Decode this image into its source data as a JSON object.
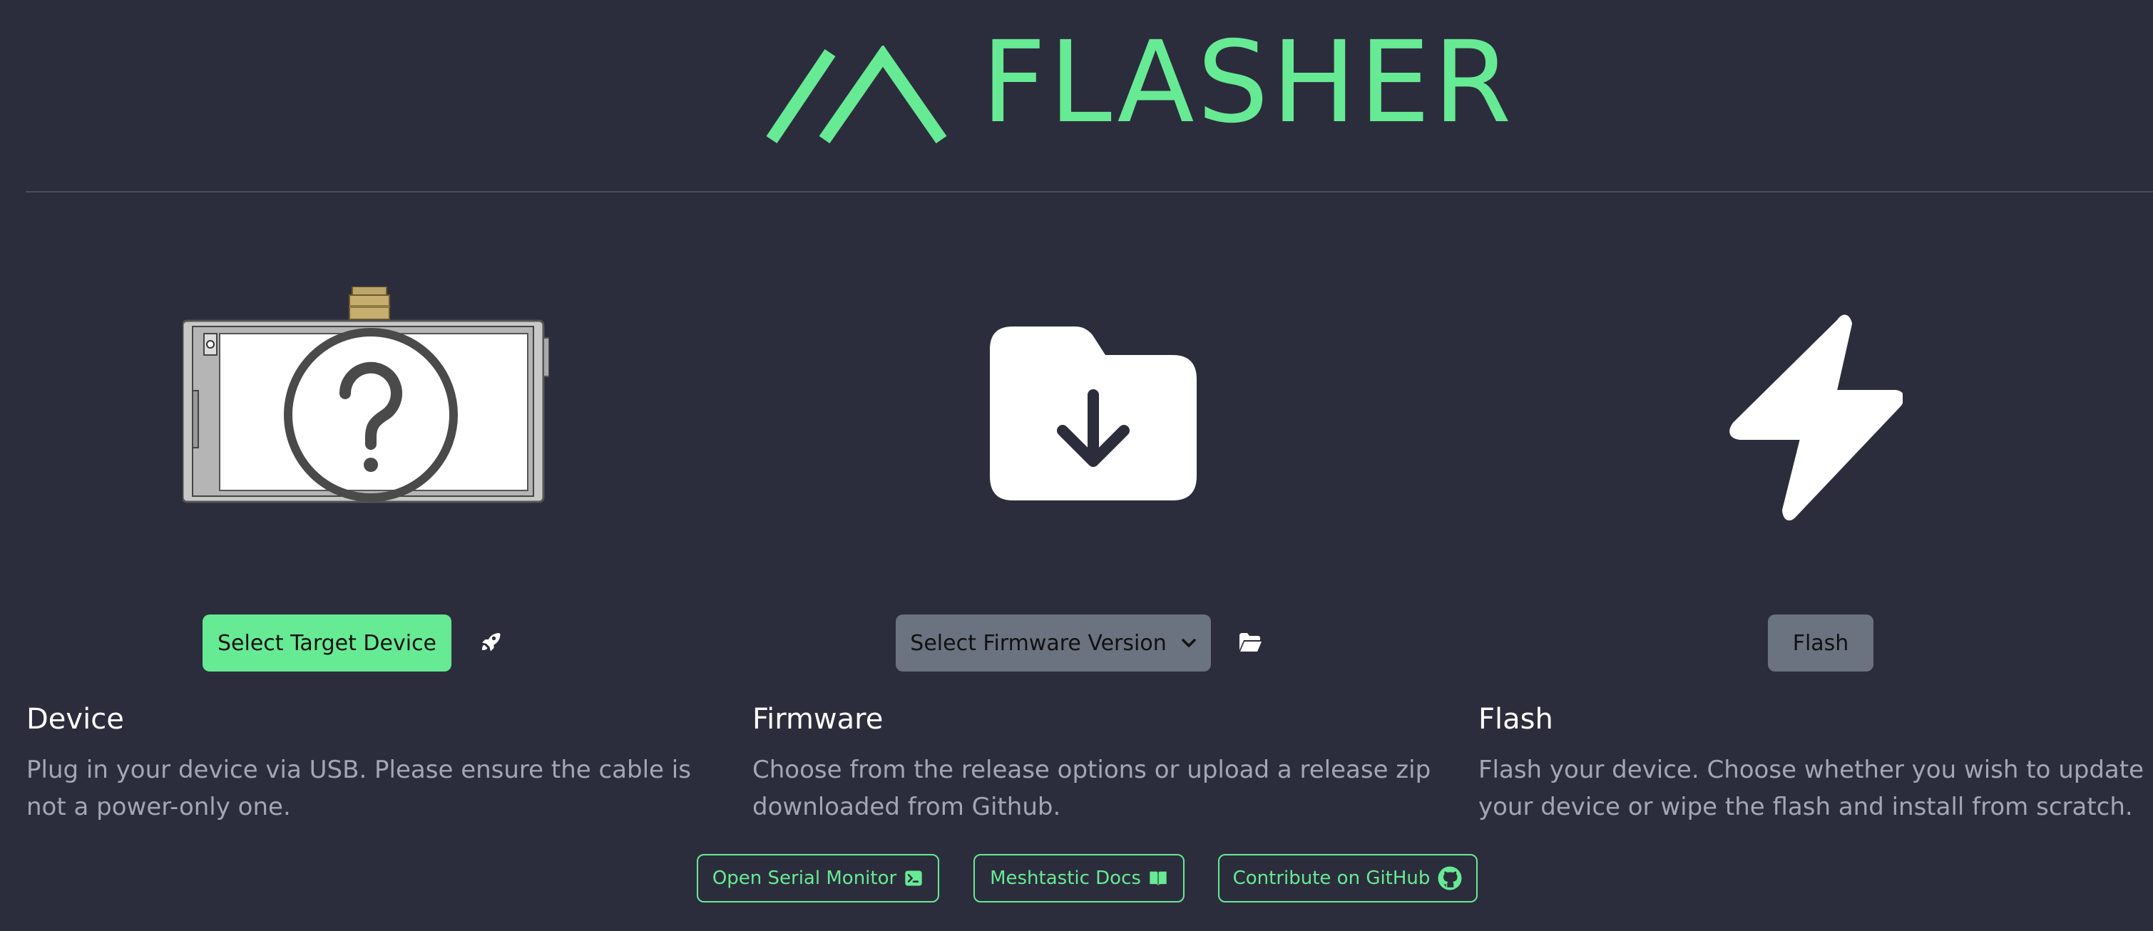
{
  "header": {
    "title": "FLASHER",
    "logo_icon": "meshtastic-logo-icon",
    "accent_color": "#67ea94"
  },
  "columns": {
    "device": {
      "button_label": "Select Target Device",
      "title": "Device",
      "description": "Plug in your device via USB. Please ensure the cable is not a power-only one.",
      "illustration": "unknown-device-icon",
      "extra_icon": "rocket-icon"
    },
    "firmware": {
      "button_label": "Select Firmware Version",
      "title": "Firmware",
      "description": "Choose from the release options or upload a release zip downloaded from Github.",
      "illustration": "folder-download-icon",
      "extra_icon": "folder-open-icon"
    },
    "flash": {
      "button_label": "Flash",
      "title": "Flash",
      "description": "Flash your device. Choose whether you wish to update your device or wipe the flash and install from scratch.",
      "illustration": "lightning-bolt-icon"
    }
  },
  "footer": {
    "serial_monitor": "Open Serial Monitor",
    "docs": "Meshtastic Docs",
    "github": "Contribute on GitHub"
  }
}
